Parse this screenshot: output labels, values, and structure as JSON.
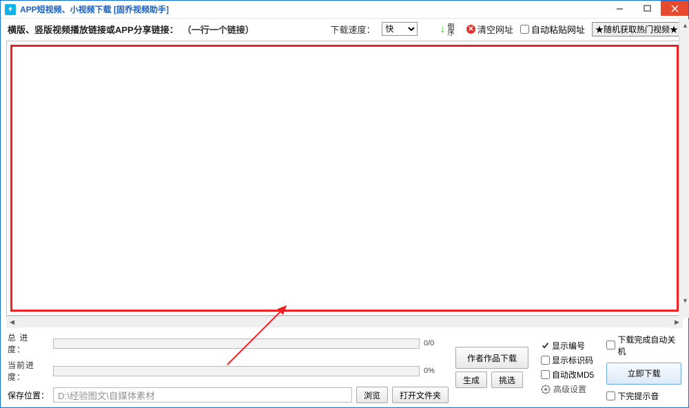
{
  "title": "APP短视频、小视频下载 [固乔视频助手]",
  "toolbar": {
    "main_label": "横版、竖版视频播放链接或APP分享链接：",
    "sub_label": "（一行一个链接）",
    "speed_label": "下载速度：",
    "speed_value": "快",
    "sort_label": "倒序",
    "clear_label": "清空网址",
    "autopaste_label": "自动粘贴网址",
    "random_btn": "★随机获取热门视频★"
  },
  "progress": {
    "total_label": "总 进 度：",
    "total_val": "0/0",
    "current_label": "当前进度：",
    "current_val": "0%"
  },
  "save": {
    "label": "保存位置：",
    "path": "D:\\经验图文\\自媒体素材",
    "browse": "浏览",
    "openfolder": "打开文件夹",
    "generate": "生成",
    "pick": "挑选"
  },
  "right": {
    "author_btn": "作者作品下载",
    "show_index": "显示编号",
    "show_marker": "显示标识码",
    "auto_md5": "自动改MD5",
    "advanced": "高级设置",
    "auto_shutdown": "下载完成自动关机",
    "download_now": "立即下载",
    "finish_sound": "下完提示音"
  }
}
